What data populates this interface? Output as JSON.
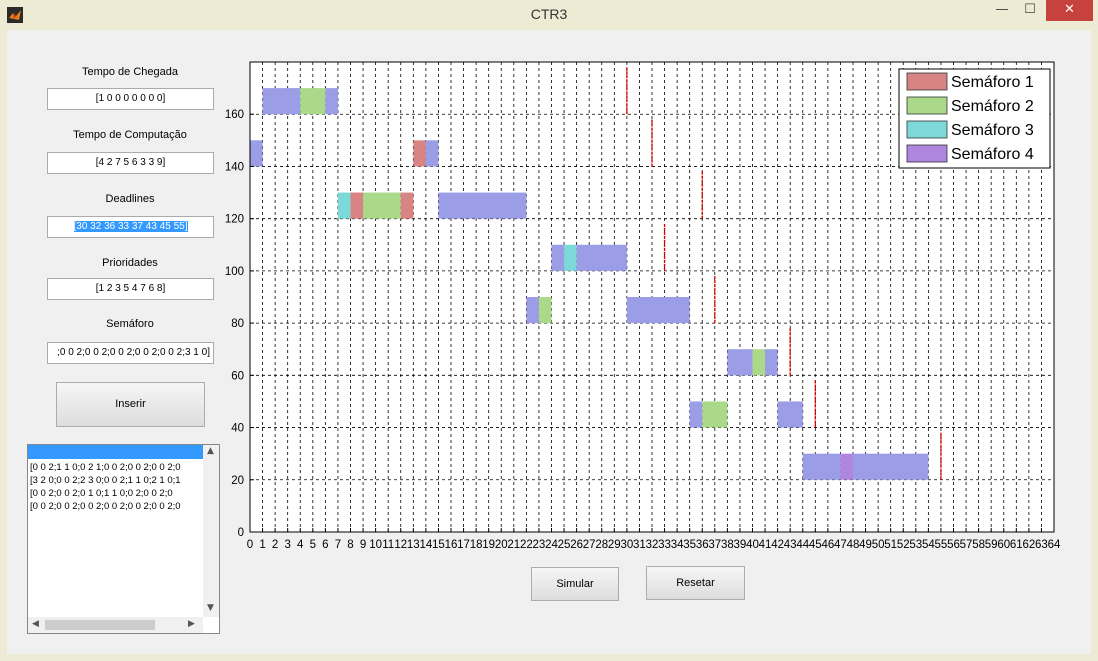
{
  "window": {
    "title": "CTR3",
    "minimize": "—",
    "maximize": "☐",
    "close": "✕"
  },
  "form": {
    "arrival_label": "Tempo de Chegada",
    "arrival_value": "[1 0 0 0 0 0 0 0]",
    "compute_label": "Tempo de Computação",
    "compute_value": "[4 2 7 5 6 3 3 9]",
    "deadlines_label": "Deadlines",
    "deadlines_value": "[30 32 36 33 37 43 45 55]",
    "priorities_label": "Prioridades",
    "priorities_value": "[1 2 3 5 4 7 6 8]",
    "semaphore_label": "Semáforo",
    "semaphore_value": ";0 0 2;0 0 2;0 0 2;0 0 2;0 0 2;3 1 0]",
    "insert_button": "Inserir"
  },
  "listbox": {
    "lines": [
      "[0 0 2;1 1 0;0 2 1;0 0 2;0 0 2;0 0 2;0",
      "[3 2 0;0 0 2;2 3 0;0 0 2;1 1 0;2 1 0;1",
      "[0 0 2;0 0 2;0 1 0;1 1 0;0 2;0 0 2;0",
      "[0 0 2;0 0 2;0 0 2;0 0 2;0 0 2;0 0 2;0"
    ]
  },
  "buttons": {
    "simulate": "Simular",
    "reset": "Resetar"
  },
  "chart_data": {
    "type": "gantt",
    "xlim": [
      0,
      64
    ],
    "ylim": [
      0,
      180
    ],
    "x_ticks": [
      0,
      1,
      2,
      3,
      4,
      5,
      6,
      7,
      8,
      9,
      10,
      11,
      12,
      13,
      14,
      15,
      16,
      17,
      18,
      19,
      20,
      21,
      22,
      23,
      24,
      25,
      26,
      27,
      28,
      29,
      30,
      31,
      32,
      33,
      34,
      35,
      36,
      37,
      38,
      39,
      40,
      41,
      42,
      43,
      44,
      45,
      46,
      47,
      48,
      49,
      50,
      51,
      52,
      53,
      54,
      55,
      56,
      57,
      58,
      59,
      60,
      61,
      62,
      63,
      64
    ],
    "y_ticks": [
      0,
      20,
      40,
      60,
      80,
      100,
      120,
      140,
      160
    ],
    "grid": "dotted",
    "legend_position": "top-right",
    "colors": {
      "exec": "#9b9de6",
      "sem1": "#d98484",
      "sem2": "#abd98a",
      "sem3": "#7dd9d9",
      "sem4": "#ae86e0",
      "deadline": "#dd0000"
    },
    "legend": [
      {
        "label": "Semáforo 1",
        "color": "#d98484"
      },
      {
        "label": "Semáforo 2",
        "color": "#abd98a"
      },
      {
        "label": "Semáforo 3",
        "color": "#7dd9d9"
      },
      {
        "label": "Semáforo 4",
        "color": "#ae86e0"
      }
    ],
    "rows": [
      {
        "y_bottom": 160,
        "segments": [
          {
            "start": 1,
            "end": 4,
            "kind": "exec"
          },
          {
            "start": 4,
            "end": 6,
            "kind": "sem2"
          },
          {
            "start": 6,
            "end": 7,
            "kind": "exec"
          }
        ],
        "deadline": 30
      },
      {
        "y_bottom": 140,
        "segments": [
          {
            "start": 0,
            "end": 1,
            "kind": "exec"
          },
          {
            "start": 13,
            "end": 14,
            "kind": "sem1"
          },
          {
            "start": 14,
            "end": 15,
            "kind": "exec"
          }
        ],
        "deadline": 32
      },
      {
        "y_bottom": 120,
        "segments": [
          {
            "start": 7,
            "end": 8,
            "kind": "sem3"
          },
          {
            "start": 8,
            "end": 9,
            "kind": "sem1"
          },
          {
            "start": 9,
            "end": 12,
            "kind": "sem2"
          },
          {
            "start": 12,
            "end": 13,
            "kind": "sem1"
          },
          {
            "start": 15,
            "end": 22,
            "kind": "exec"
          }
        ],
        "deadline": 36
      },
      {
        "y_bottom": 100,
        "segments": [
          {
            "start": 24,
            "end": 25,
            "kind": "exec"
          },
          {
            "start": 25,
            "end": 26,
            "kind": "sem3"
          },
          {
            "start": 26,
            "end": 30,
            "kind": "exec"
          }
        ],
        "deadline": 33
      },
      {
        "y_bottom": 80,
        "segments": [
          {
            "start": 22,
            "end": 23,
            "kind": "exec"
          },
          {
            "start": 23,
            "end": 24,
            "kind": "sem2"
          },
          {
            "start": 30,
            "end": 35,
            "kind": "exec"
          }
        ],
        "deadline": 37
      },
      {
        "y_bottom": 60,
        "segments": [
          {
            "start": 38,
            "end": 40,
            "kind": "exec"
          },
          {
            "start": 40,
            "end": 41,
            "kind": "sem2"
          },
          {
            "start": 41,
            "end": 42,
            "kind": "exec"
          }
        ],
        "deadline": 43
      },
      {
        "y_bottom": 40,
        "segments": [
          {
            "start": 35,
            "end": 36,
            "kind": "exec"
          },
          {
            "start": 36,
            "end": 38,
            "kind": "sem2"
          },
          {
            "start": 42,
            "end": 44,
            "kind": "exec"
          }
        ],
        "deadline": 45
      },
      {
        "y_bottom": 20,
        "segments": [
          {
            "start": 44,
            "end": 47,
            "kind": "exec"
          },
          {
            "start": 47,
            "end": 48,
            "kind": "sem4"
          },
          {
            "start": 48,
            "end": 54,
            "kind": "exec"
          }
        ],
        "deadline": 55
      }
    ],
    "bar_height": 10
  }
}
